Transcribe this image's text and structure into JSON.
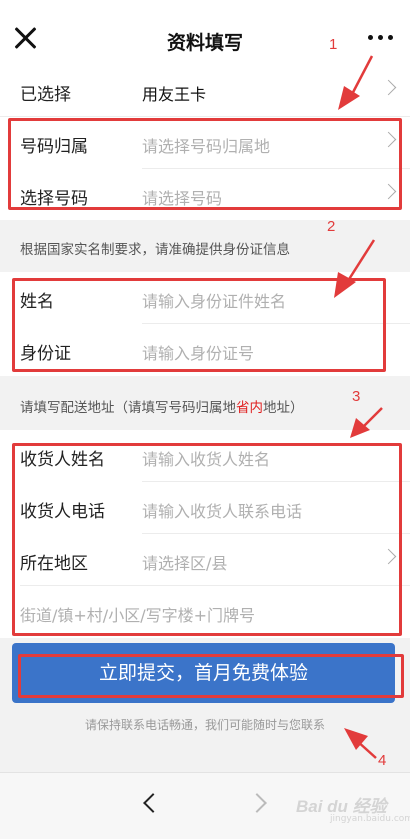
{
  "header": {
    "title": "资料填写",
    "close_icon": "close-icon",
    "more_icon": "more-dots-icon"
  },
  "card_section": {
    "selected": {
      "label": "已选择",
      "value": "用友王卡"
    },
    "number_region": {
      "label": "号码归属",
      "placeholder": "请选择号码归属地"
    },
    "pick_number": {
      "label": "选择号码",
      "placeholder": "请选择号码"
    }
  },
  "id_note": "根据国家实名制要求，请准确提供身份证信息",
  "id_section": {
    "name": {
      "label": "姓名",
      "placeholder": "请输入身份证件姓名"
    },
    "id_number": {
      "label": "身份证",
      "placeholder": "请输入身份证号"
    }
  },
  "address_note": {
    "prefix": "请填写配送地址（请填写号码归属地",
    "highlight": "省内",
    "suffix": "地址）"
  },
  "address_section": {
    "receiver_name": {
      "label": "收货人姓名",
      "placeholder": "请输入收货人姓名"
    },
    "receiver_phone": {
      "label": "收货人电话",
      "placeholder": "请输入收货人联系电话"
    },
    "region": {
      "label": "所在地区",
      "placeholder": "请选择区/县"
    },
    "street": {
      "placeholder": "街道/镇+村/小区/写字楼+门牌号"
    }
  },
  "submit": {
    "label": "立即提交，首月免费体验"
  },
  "hint": "请保持联系电话畅通，我们可能随时与您联系",
  "annotations": [
    "1",
    "2",
    "3",
    "4"
  ],
  "watermark": {
    "text": "Bai du 经验",
    "sub": "jingyan.baidu.com"
  },
  "colors": {
    "accent": "#3b74c9",
    "annotation": "#e23b3b",
    "highlight": "#e02020"
  }
}
